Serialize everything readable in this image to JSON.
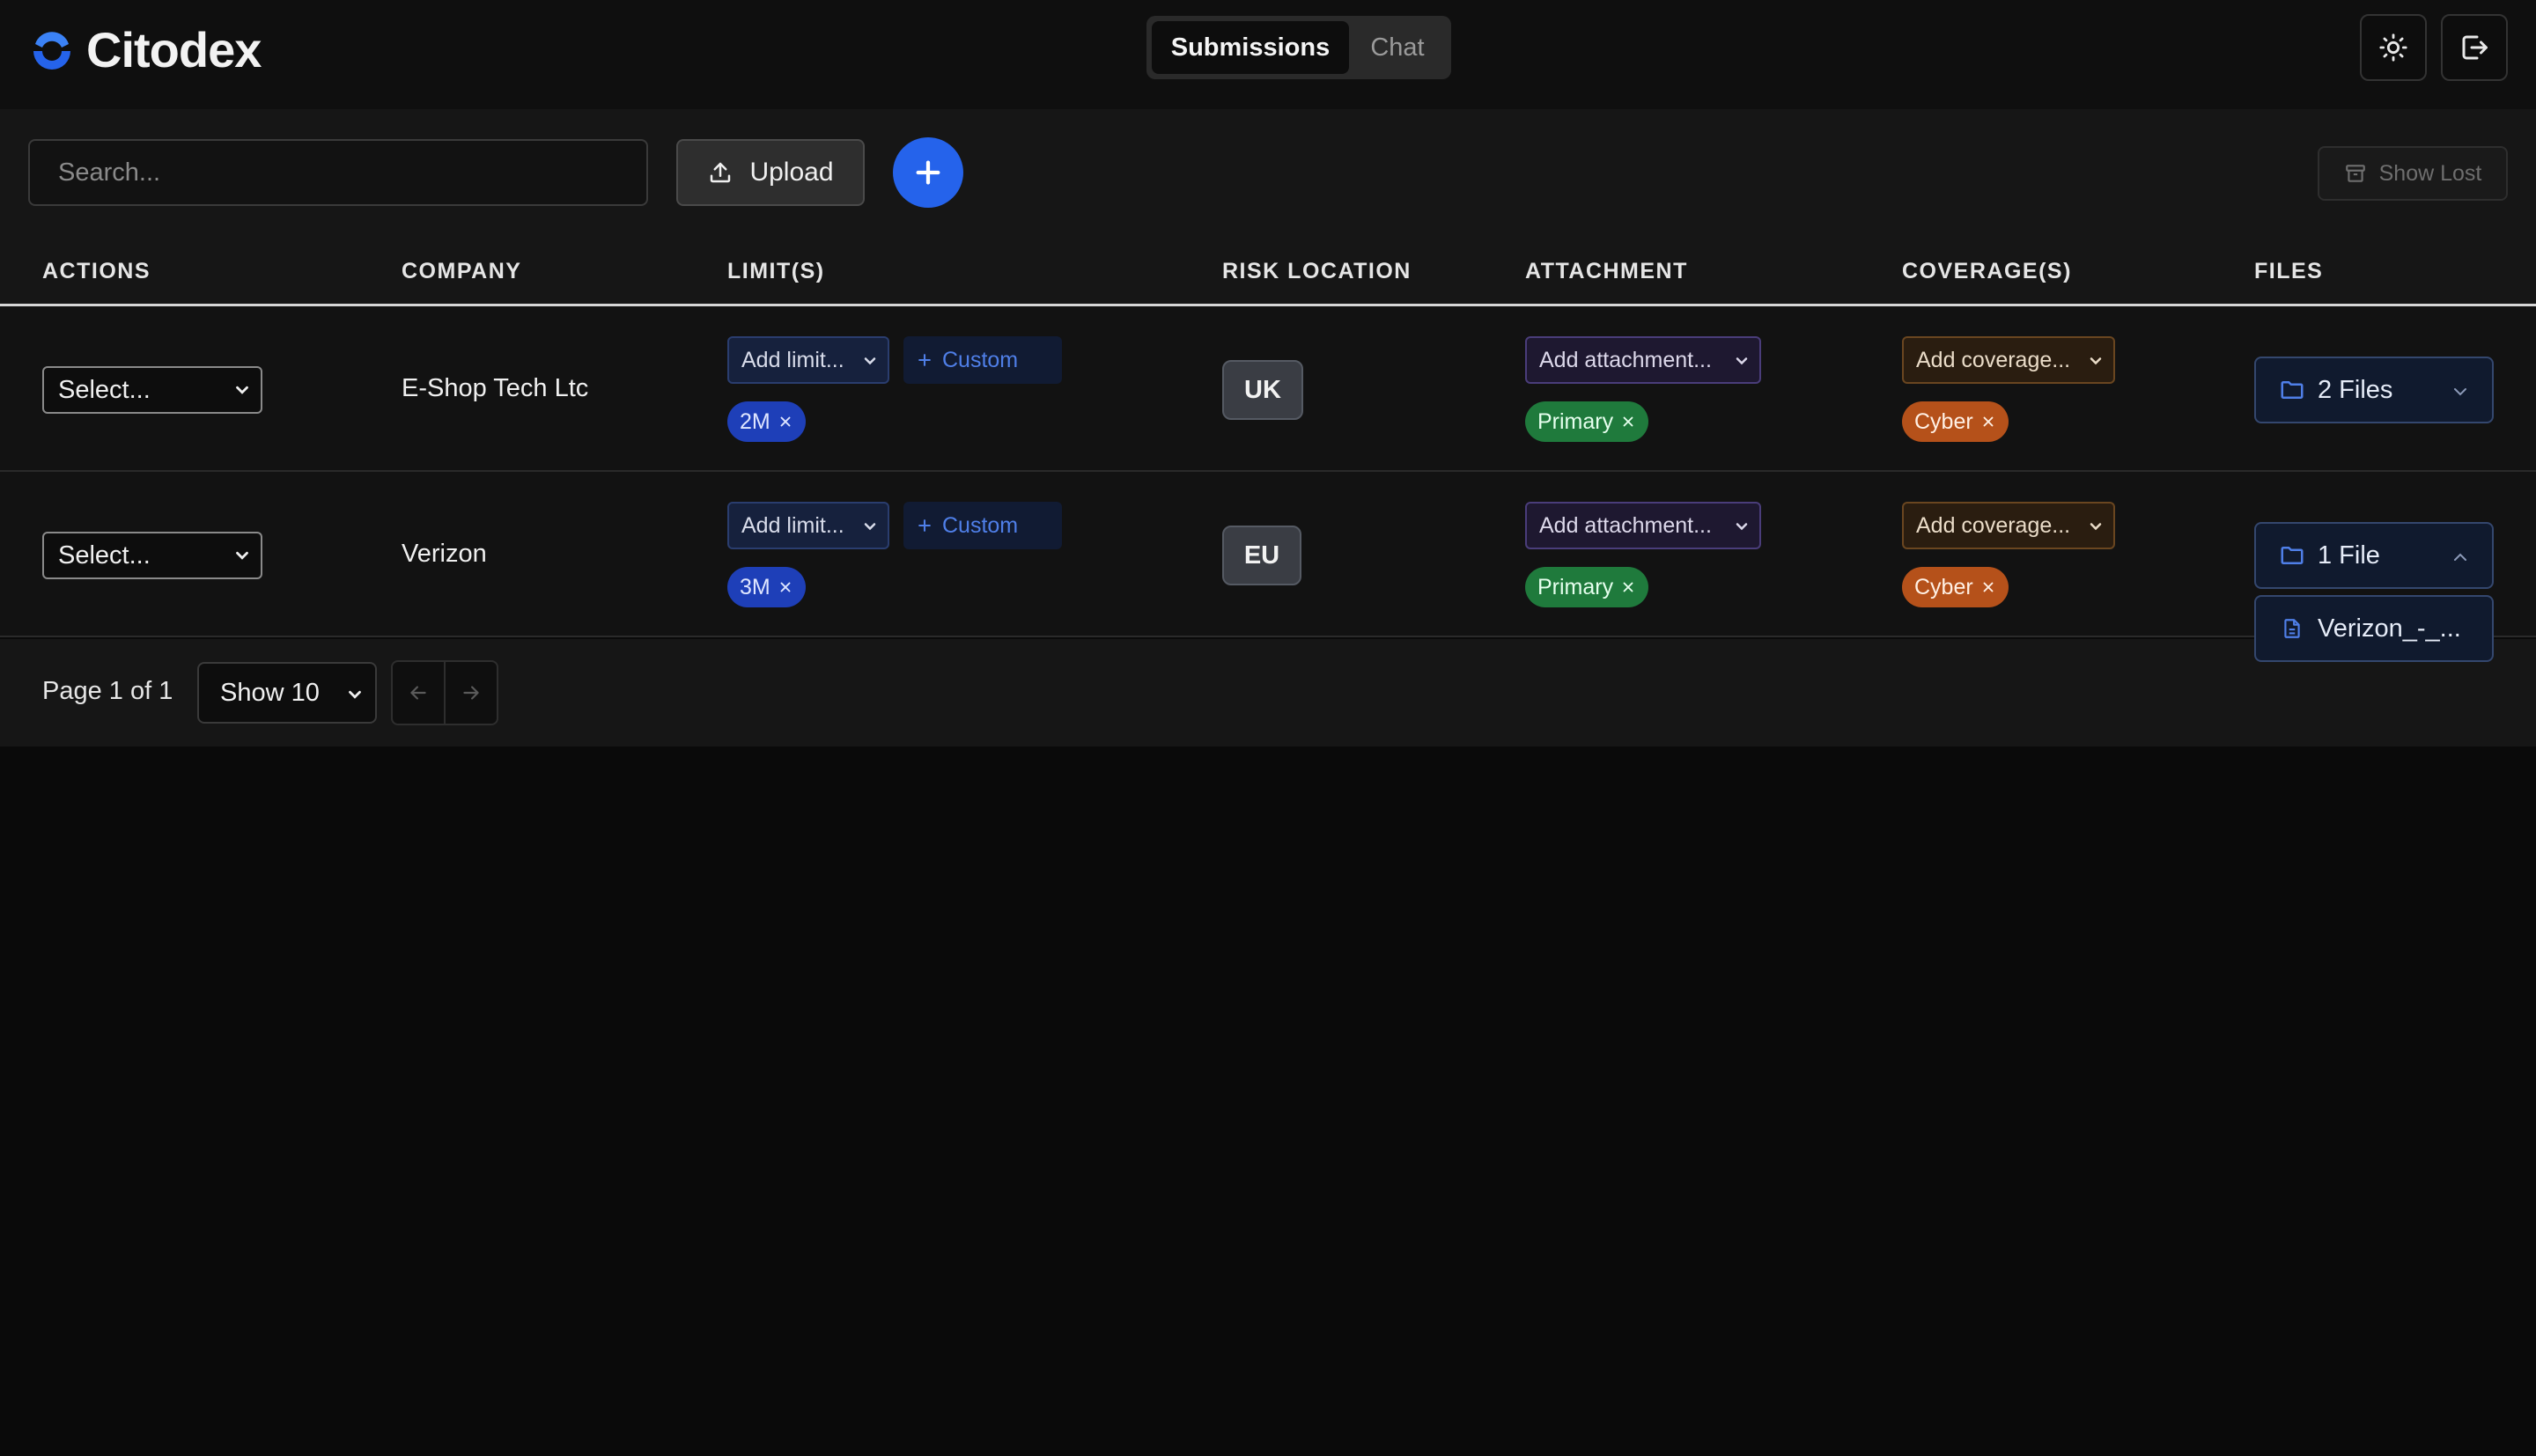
{
  "app": {
    "name": "Citodex",
    "brand_color": "#2563eb"
  },
  "nav": {
    "tabs": [
      {
        "label": "Submissions",
        "active": true
      },
      {
        "label": "Chat",
        "active": false
      }
    ],
    "icons": [
      "sun-icon",
      "logout-icon"
    ]
  },
  "toolbar": {
    "search_placeholder": "Search...",
    "upload_label": "Upload",
    "add_icon": "plus-icon",
    "show_lost_label": "Show Lost"
  },
  "table": {
    "headers": [
      "ACTIONS",
      "COMPANY",
      "LIMIT(S)",
      "RISK LOCATION",
      "ATTACHMENT",
      "COVERAGE(S)",
      "FILES"
    ],
    "rows": [
      {
        "action": "Select...",
        "company": "E-Shop Tech Ltc",
        "limit_placeholder": "Add limit...",
        "custom_label": "Custom",
        "limit_chip": "2M",
        "risk_location": "UK",
        "attachment_placeholder": "Add attachment...",
        "attachment_chip": "Primary",
        "coverage_placeholder": "Add coverage...",
        "coverage_chip": "Cyber",
        "files_label": "2 Files",
        "files_expanded": false
      },
      {
        "action": "Select...",
        "company": "Verizon",
        "limit_placeholder": "Add limit...",
        "custom_label": "Custom",
        "limit_chip": "3M",
        "risk_location": "EU",
        "attachment_placeholder": "Add attachment...",
        "attachment_chip": "Primary",
        "coverage_placeholder": "Add coverage...",
        "coverage_chip": "Cyber",
        "files_label": "1 File",
        "files_expanded": true,
        "file_items": [
          "Verizon_-_..."
        ]
      }
    ]
  },
  "pagination": {
    "page_label": "Page 1 of 1",
    "page_size_label": "Show 10"
  }
}
